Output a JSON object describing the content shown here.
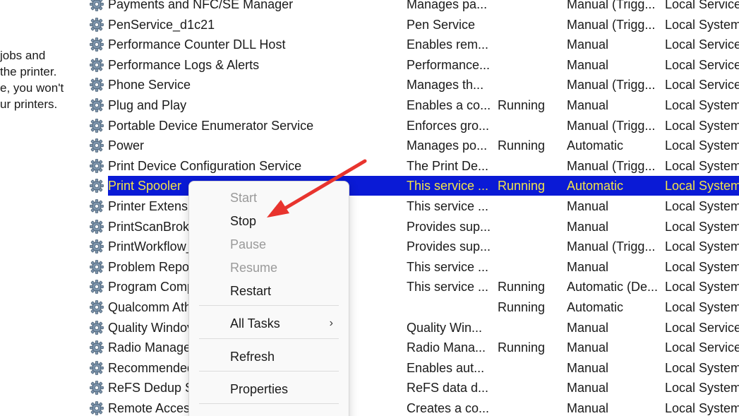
{
  "description_pane": {
    "lines": [
      "jobs and",
      " the printer.",
      "e, you won't",
      "ur printers."
    ]
  },
  "services": [
    {
      "name": "Payments and NFC/SE Manager",
      "description": "Manages pa...",
      "status": "",
      "startup": "Manual (Trigg...",
      "logon": "Local Service",
      "selected": false
    },
    {
      "name": "PenService_d1c21",
      "description": "Pen Service",
      "status": "",
      "startup": "Manual (Trigg...",
      "logon": "Local System",
      "selected": false
    },
    {
      "name": "Performance Counter DLL Host",
      "description": "Enables rem...",
      "status": "",
      "startup": "Manual",
      "logon": "Local Service",
      "selected": false
    },
    {
      "name": "Performance Logs & Alerts",
      "description": "Performance...",
      "status": "",
      "startup": "Manual",
      "logon": "Local Service",
      "selected": false
    },
    {
      "name": "Phone Service",
      "description": "Manages th...",
      "status": "",
      "startup": "Manual (Trigg...",
      "logon": "Local Service",
      "selected": false
    },
    {
      "name": "Plug and Play",
      "description": "Enables a co...",
      "status": "Running",
      "startup": "Manual",
      "logon": "Local System",
      "selected": false
    },
    {
      "name": "Portable Device Enumerator Service",
      "description": "Enforces gro...",
      "status": "",
      "startup": "Manual (Trigg...",
      "logon": "Local System",
      "selected": false
    },
    {
      "name": "Power",
      "description": "Manages po...",
      "status": "Running",
      "startup": "Automatic",
      "logon": "Local System",
      "selected": false
    },
    {
      "name": "Print Device Configuration Service",
      "description": "The Print De...",
      "status": "",
      "startup": "Manual (Trigg...",
      "logon": "Local System",
      "selected": false
    },
    {
      "name": "Print Spooler",
      "description": "This service ...",
      "status": "Running",
      "startup": "Automatic",
      "logon": "Local System",
      "selected": true
    },
    {
      "name": "Printer Extensic",
      "description": "This service ...",
      "status": "",
      "startup": "Manual",
      "logon": "Local System",
      "selected": false
    },
    {
      "name": "PrintScanBroke",
      "description": "Provides sup...",
      "status": "",
      "startup": "Manual",
      "logon": "Local System",
      "selected": false
    },
    {
      "name": "PrintWorkflow_",
      "description": "Provides sup...",
      "status": "",
      "startup": "Manual (Trigg...",
      "logon": "Local System",
      "selected": false
    },
    {
      "name": "Problem Repor",
      "description": "This service ...",
      "status": "",
      "startup": "Manual",
      "logon": "Local System",
      "selected": false
    },
    {
      "name": "Program Comp",
      "description": "This service ...",
      "status": "Running",
      "startup": "Automatic (De...",
      "logon": "Local System",
      "selected": false
    },
    {
      "name": "Qualcomm Ath",
      "description": "",
      "status": "Running",
      "startup": "Automatic",
      "logon": "Local System",
      "selected": false
    },
    {
      "name": "Quality Windov",
      "description": "Quality Win...",
      "status": "",
      "startup": "Manual",
      "logon": "Local Service",
      "selected": false
    },
    {
      "name": "Radio Manage",
      "description": "Radio Mana...",
      "status": "Running",
      "startup": "Manual",
      "logon": "Local Service",
      "selected": false
    },
    {
      "name": "Recommended",
      "description": "Enables aut...",
      "status": "",
      "startup": "Manual",
      "logon": "Local System",
      "selected": false
    },
    {
      "name": "ReFS Dedup Se",
      "description": "ReFS data d...",
      "status": "",
      "startup": "Manual",
      "logon": "Local System",
      "selected": false
    },
    {
      "name": "Remote Access",
      "description": "Creates a co...",
      "status": "",
      "startup": "Manual",
      "logon": "Local System",
      "selected": false
    }
  ],
  "context_menu": {
    "start": "Start",
    "stop": "Stop",
    "pause": "Pause",
    "resume": "Resume",
    "restart": "Restart",
    "all_tasks": "All Tasks",
    "all_tasks_arrow": "›",
    "refresh": "Refresh",
    "properties": "Properties"
  },
  "colors": {
    "selection_bg": "#0a1ad6",
    "selection_text": "#f2e34a",
    "annotation_arrow": "#e8342e"
  },
  "icons": {
    "service_icon": "gear-icon",
    "submenu": "chevron-right-icon"
  }
}
